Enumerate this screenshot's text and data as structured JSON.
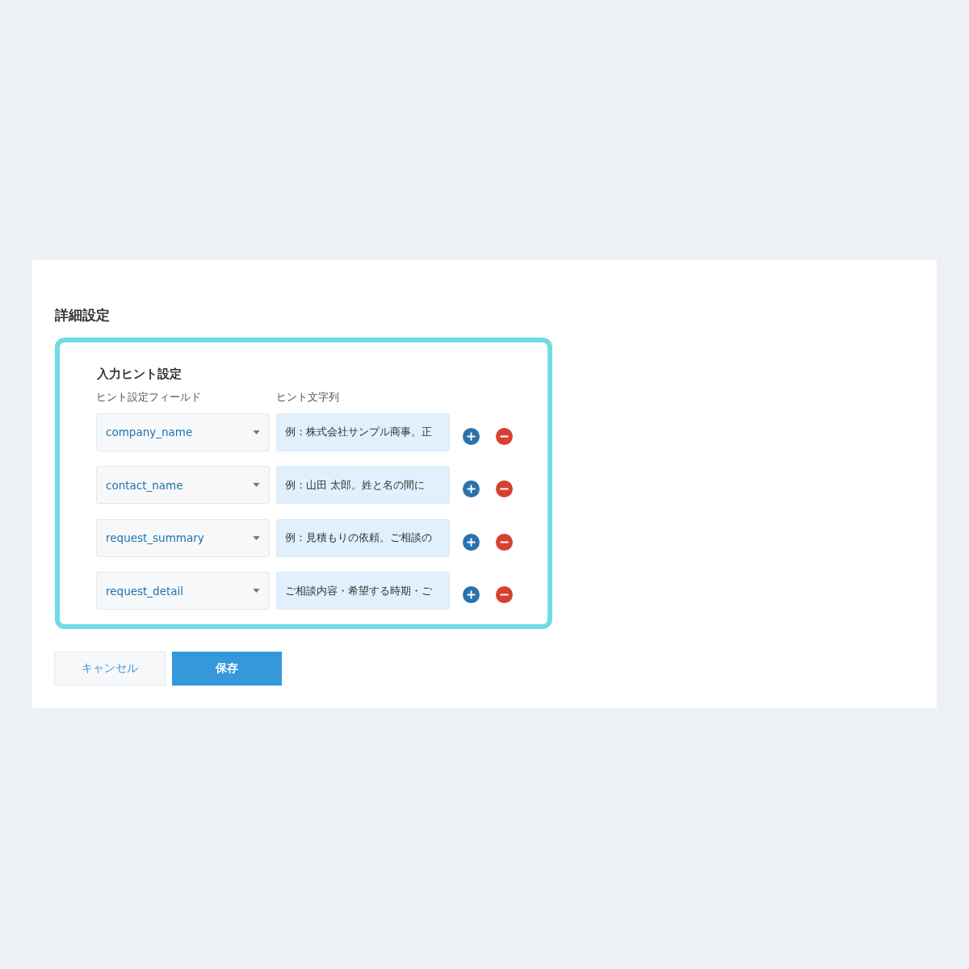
{
  "section": {
    "title": "詳細設定"
  },
  "hint_settings": {
    "highlighted": true,
    "title": "入力ヒント設定",
    "columns": [
      "ヒント設定フィールド",
      "ヒント文字列"
    ],
    "rows": [
      {
        "field": "company_name",
        "hint": "例：株式会社サンプル商事。正"
      },
      {
        "field": "contact_name",
        "hint": "例：山田 太郎。姓と名の間に"
      },
      {
        "field": "request_summary",
        "hint": "例：見積もりの依頼。ご相談の"
      },
      {
        "field": "request_detail",
        "hint": "ご相談内容・希望する時期・ご"
      }
    ]
  },
  "buttons": [
    {
      "label": "キャンセル",
      "kind": "secondary"
    },
    {
      "label": "保存",
      "kind": "primary"
    }
  ]
}
